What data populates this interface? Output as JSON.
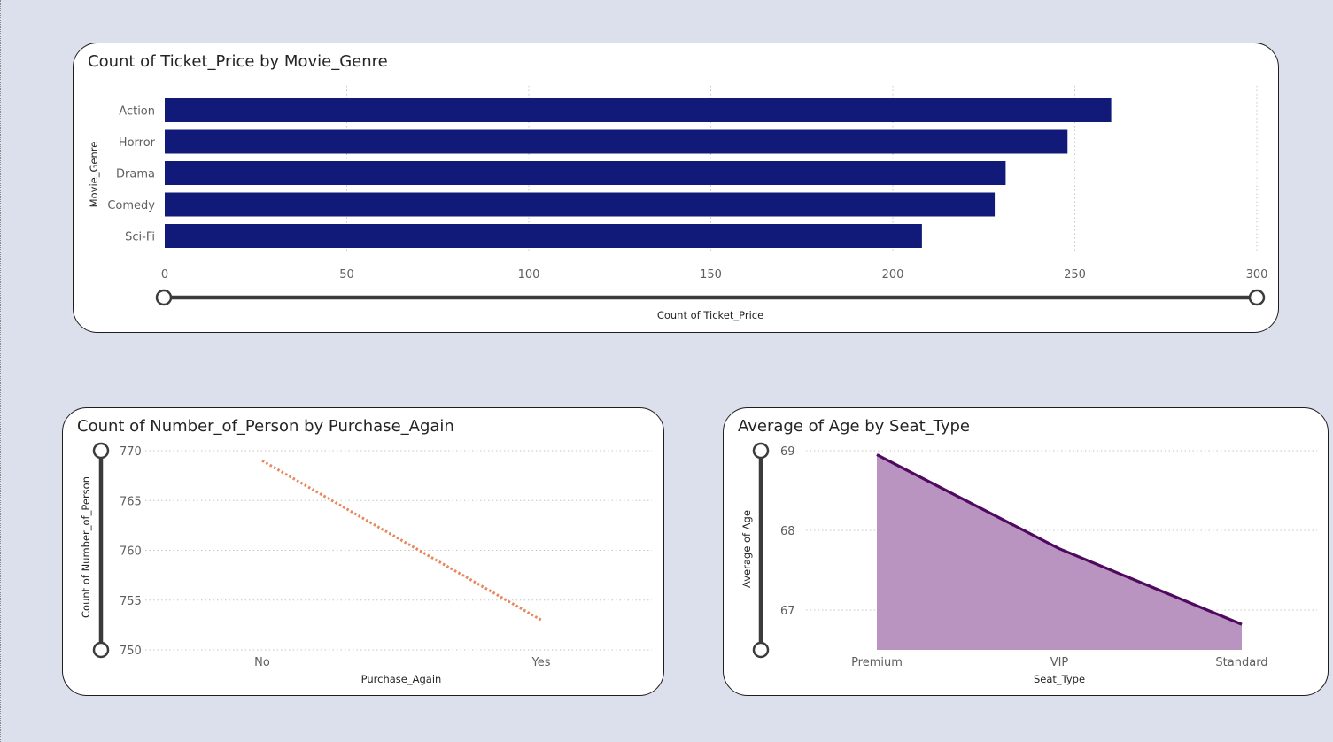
{
  "charts": {
    "genre": {
      "title": "Count of Ticket_Price by Movie_Genre",
      "xlabel": "Count of Ticket_Price",
      "ylabel": "Movie_Genre",
      "bar_color": "#111a78"
    },
    "purchase": {
      "title": "Count of Number_of_Person by Purchase_Again",
      "xlabel": "Purchase_Again",
      "ylabel": "Count of Number_of_Person",
      "line_color": "#e8875a"
    },
    "seat": {
      "title": "Average of Age by Seat_Type",
      "xlabel": "Seat_Type",
      "ylabel": "Average of Age",
      "line_color": "#4f0a5f",
      "fill_color": "#b994c0"
    }
  },
  "chart_data": [
    {
      "type": "bar",
      "orientation": "horizontal",
      "title": "Count of Ticket_Price by Movie_Genre",
      "xlabel": "Count of Ticket_Price",
      "ylabel": "Movie_Genre",
      "categories": [
        "Action",
        "Horror",
        "Drama",
        "Comedy",
        "Sci-Fi"
      ],
      "values": [
        260,
        248,
        231,
        228,
        208
      ],
      "xlim": [
        0,
        300
      ],
      "xticks": [
        0,
        50,
        100,
        150,
        200,
        250,
        300
      ],
      "grid": true
    },
    {
      "type": "line",
      "title": "Count of Number_of_Person by Purchase_Again",
      "xlabel": "Purchase_Again",
      "ylabel": "Count of Number_of_Person",
      "categories": [
        "No",
        "Yes"
      ],
      "values": [
        769,
        753
      ],
      "ylim": [
        750,
        770
      ],
      "yticks": [
        750,
        755,
        760,
        765,
        770
      ],
      "line_style": "dotted",
      "grid": true
    },
    {
      "type": "area",
      "title": "Average of Age by Seat_Type",
      "xlabel": "Seat_Type",
      "ylabel": "Average of Age",
      "categories": [
        "Premium",
        "VIP",
        "Standard"
      ],
      "values": [
        68.95,
        67.77,
        66.82
      ],
      "ylim": [
        66.5,
        69
      ],
      "yticks": [
        67,
        68,
        69
      ],
      "grid": true
    }
  ]
}
